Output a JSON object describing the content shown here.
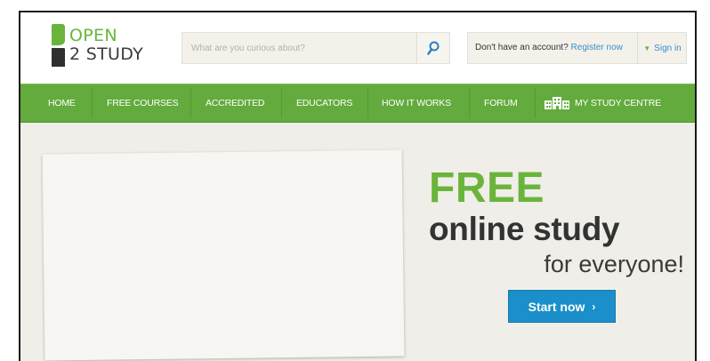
{
  "logo": {
    "line1": "OPEN",
    "line2": "2 STUDY"
  },
  "search": {
    "placeholder": "What are you curious about?",
    "icon": "search-icon"
  },
  "account": {
    "prompt": "Don't have an account?",
    "register_label": "Register now",
    "signin_label": "Sign in",
    "signin_icon": "chevron-down-icon"
  },
  "nav": {
    "items": [
      {
        "label": "HOME"
      },
      {
        "label": "FREE COURSES"
      },
      {
        "label": "ACCREDITED"
      },
      {
        "label": "EDUCATORS"
      },
      {
        "label": "HOW IT WORKS"
      },
      {
        "label": "FORUM"
      },
      {
        "label": "MY STUDY CENTRE",
        "icon": "building-icon"
      }
    ]
  },
  "hero": {
    "headline": "FREE",
    "subline": "online study",
    "tagline": "for everyone!",
    "cta_label": "Start now",
    "cta_icon": "chevron-right-icon"
  },
  "colors": {
    "brand_green": "#62ab3c",
    "accent_blue": "#1b8fc9",
    "link_blue": "#3a8fc6",
    "hero_bg": "#f0eee8"
  }
}
